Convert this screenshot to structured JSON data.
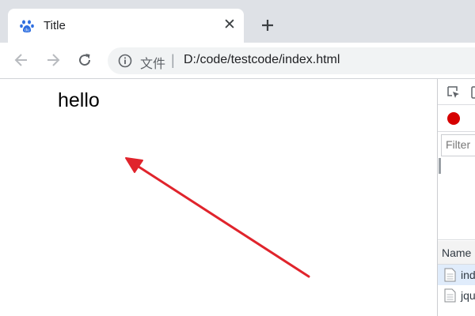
{
  "tab": {
    "title": "Title",
    "favicon": "baidu-paw-icon",
    "close": "✕",
    "new_tab_icon": "plus-icon"
  },
  "toolbar": {
    "back_icon": "arrow-left-icon",
    "forward_icon": "arrow-right-icon",
    "reload_icon": "reload-icon",
    "info_icon": "info-circle-icon",
    "secure_label": "文件",
    "separator": "|",
    "url": "D:/code/testcode/index.html"
  },
  "page": {
    "text": "hello",
    "annotation": {
      "type": "arrow",
      "color": "#e0242c"
    }
  },
  "devtools": {
    "filter_placeholder": "Filter",
    "column_header": "Name",
    "requests": [
      {
        "name": "index.html",
        "selected": true
      },
      {
        "name": "jquery.js",
        "selected": false
      }
    ],
    "record_color": "#d60000"
  },
  "colors": {
    "tab_strip": "#dee1e6",
    "omnibox": "#f1f3f4",
    "favicon": "#2f6fe0",
    "selected_row": "#e0ecfb"
  }
}
